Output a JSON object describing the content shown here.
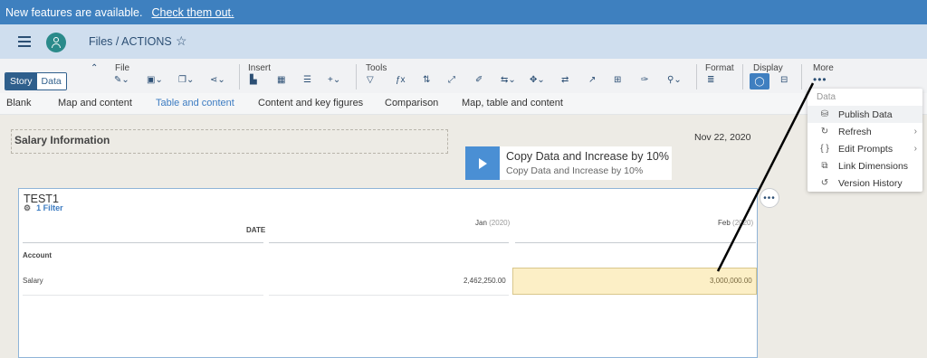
{
  "banner": {
    "text": "New features are available.",
    "link": "Check them out."
  },
  "shellbar": {
    "breadcrumb": "Files / ACTIONS"
  },
  "toolbar": {
    "modes": [
      "Story",
      "Data"
    ],
    "groups": {
      "file": "File",
      "insert": "Insert",
      "tools": "Tools",
      "format": "Format",
      "display": "Display",
      "more": "More"
    },
    "more_dots": "•••"
  },
  "layouts": [
    "Blank",
    "Map and content",
    "Table and content",
    "Content and key figures",
    "Comparison",
    "Map, table and content"
  ],
  "page": {
    "title": "Salary Information",
    "date": "Nov 22, 2020"
  },
  "action": {
    "title": "Copy Data and Increase by 10%",
    "subtitle": "Copy Data and Increase by 10%"
  },
  "table": {
    "title": "TEST1",
    "filter": "1 Filter",
    "date_header": "DATE",
    "col1": {
      "month": "Jan",
      "year": "(2020)"
    },
    "col2": {
      "month": "Feb",
      "year": "(2020)"
    },
    "account_label": "Account",
    "row_label": "Salary",
    "val1": "2,462,250.00",
    "val2": "3,000,000.00"
  },
  "menu": {
    "header": "Data",
    "items": [
      {
        "label": "Publish Data",
        "icon": "publish-icon"
      },
      {
        "label": "Refresh",
        "icon": "refresh-icon"
      },
      {
        "label": "Edit Prompts",
        "icon": "braces-icon"
      },
      {
        "label": "Link Dimensions",
        "icon": "link-dimensions-icon"
      },
      {
        "label": "Version History",
        "icon": "history-icon"
      }
    ]
  },
  "colors": {
    "banner": "#3e80bf",
    "shell": "#cfdeee",
    "accent": "#3d7cc2",
    "highlight": "#fcefc6"
  }
}
